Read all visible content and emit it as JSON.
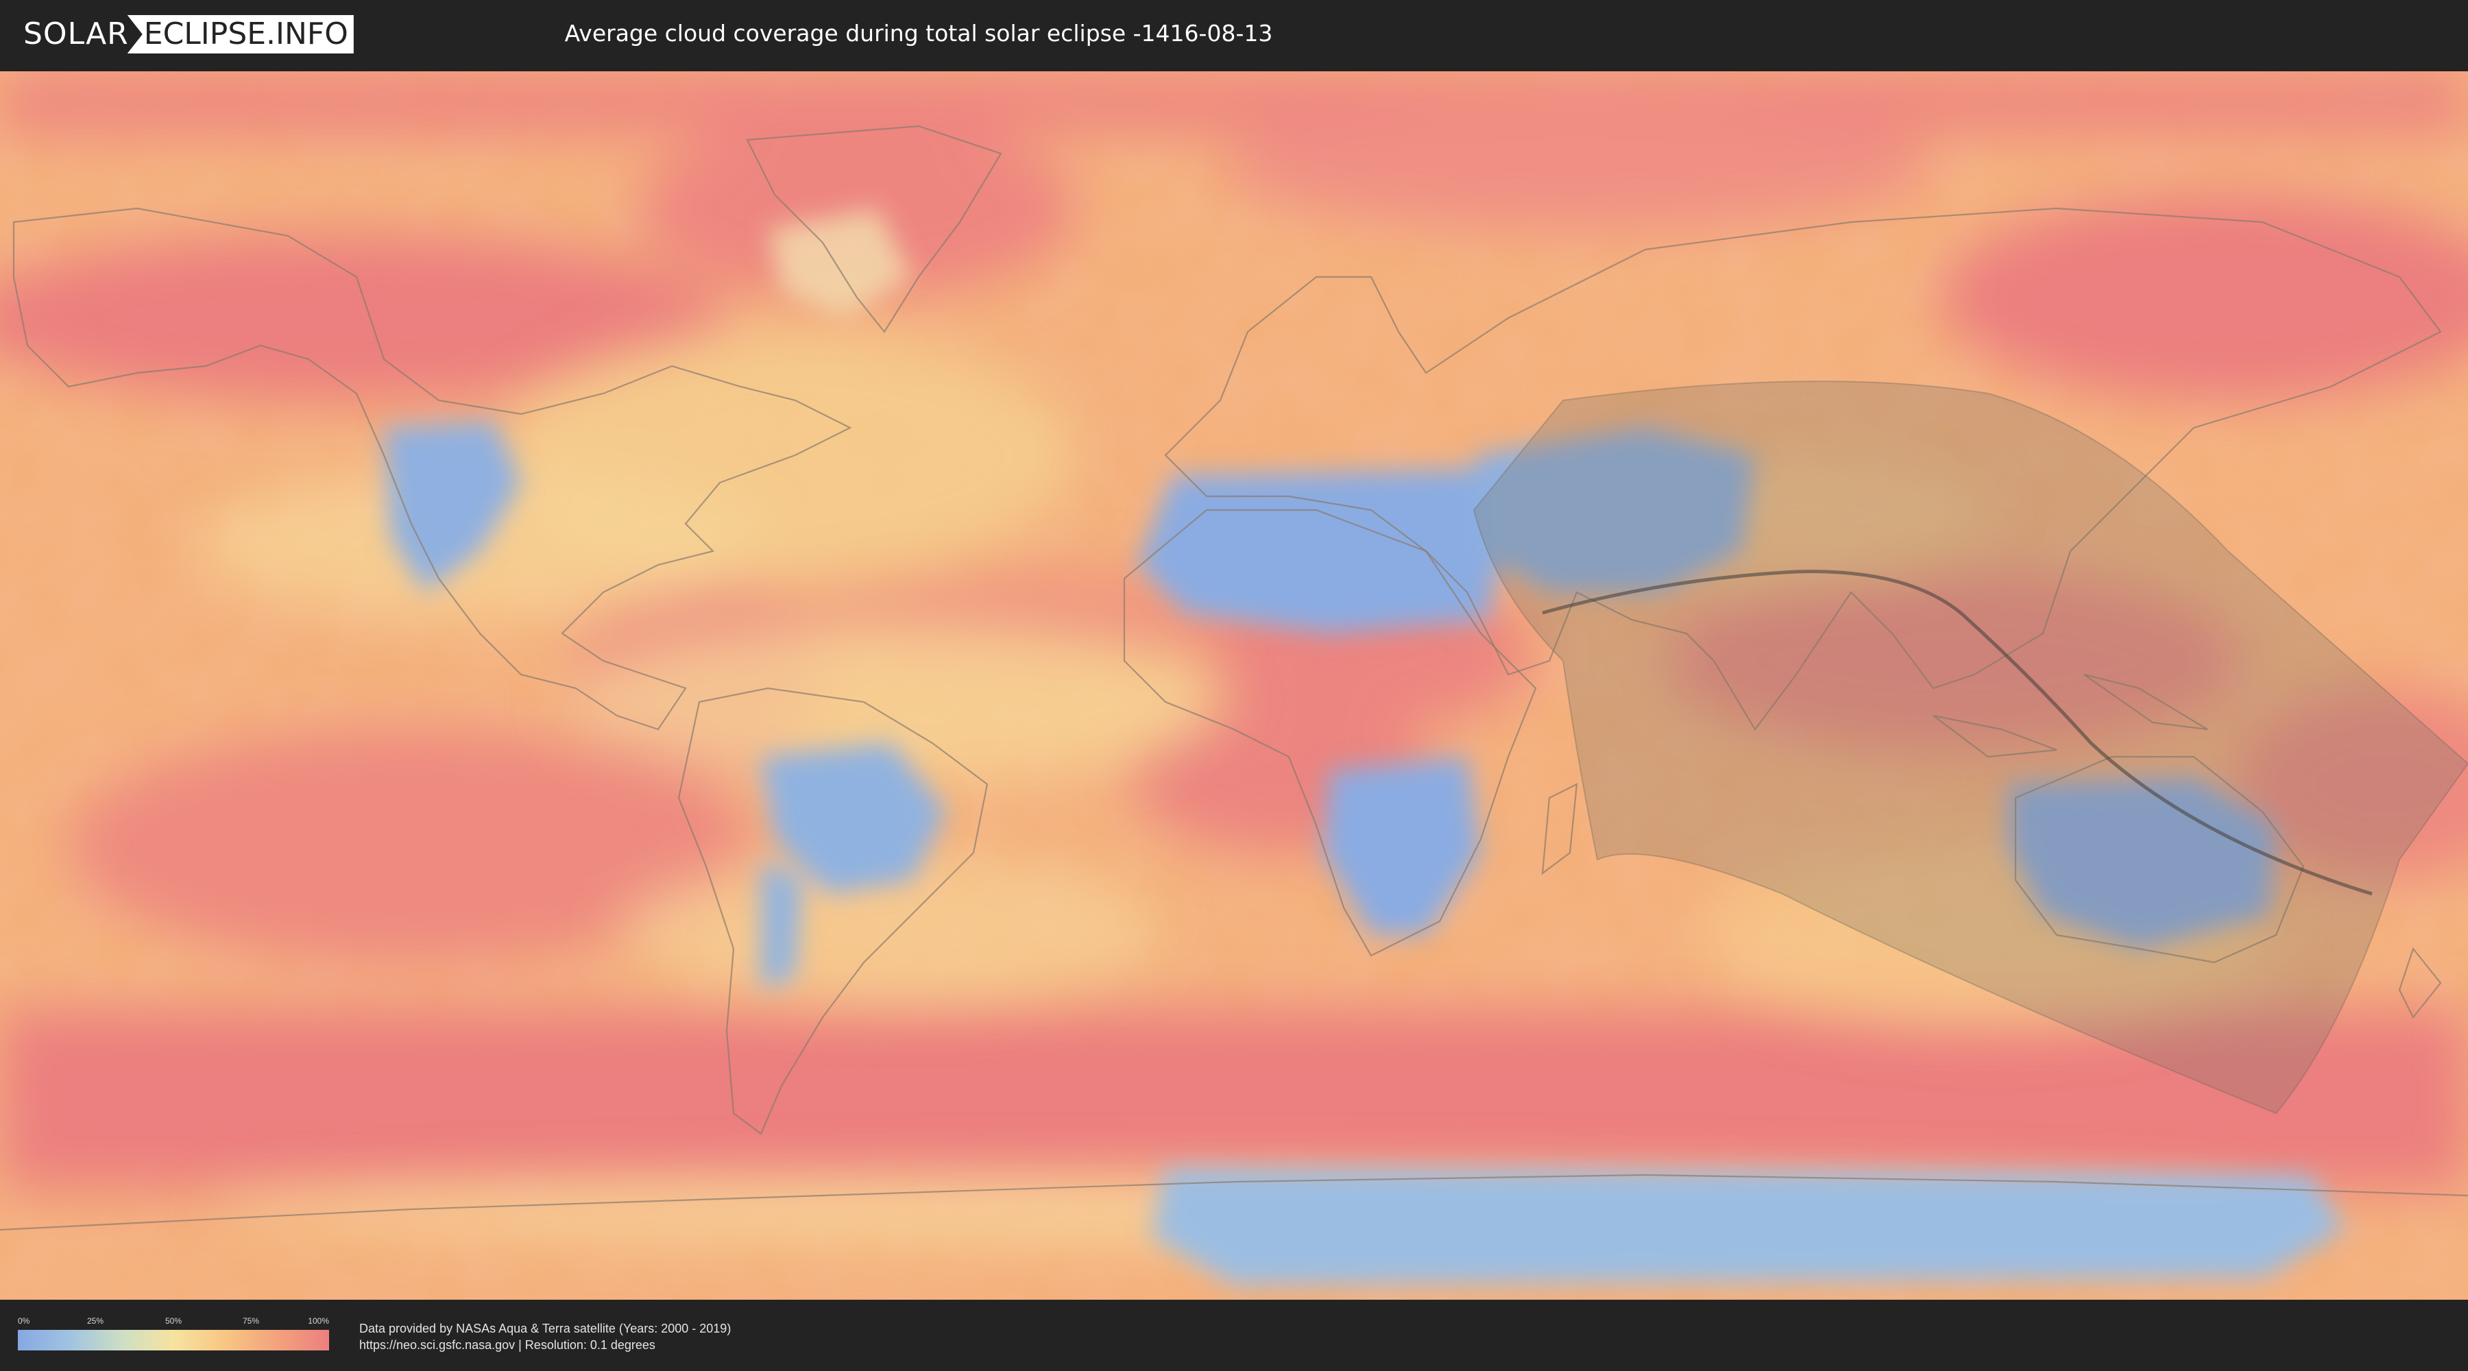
{
  "header": {
    "logo_left": "SOLAR",
    "logo_right": "ECLIPSE.INFO",
    "title": "Average cloud coverage during total solar eclipse -1416-08-13"
  },
  "map": {
    "layer": "average cloud coverage",
    "colors": {
      "clear": "#86a8e2",
      "partly": "#f6e3a0",
      "overcast": "#ec7f7f",
      "eclipse_zone": "#7a7468",
      "central_line": "#4a4540"
    }
  },
  "legend": {
    "ticks": [
      "0%",
      "25%",
      "50%",
      "75%",
      "100%"
    ]
  },
  "credits": {
    "line1": "Data provided by NASAs Aqua & Terra satellite (Years: 2000 - 2019)",
    "line2": "https://neo.sci.gsfc.nasa.gov | Resolution: 0.1 degrees"
  }
}
